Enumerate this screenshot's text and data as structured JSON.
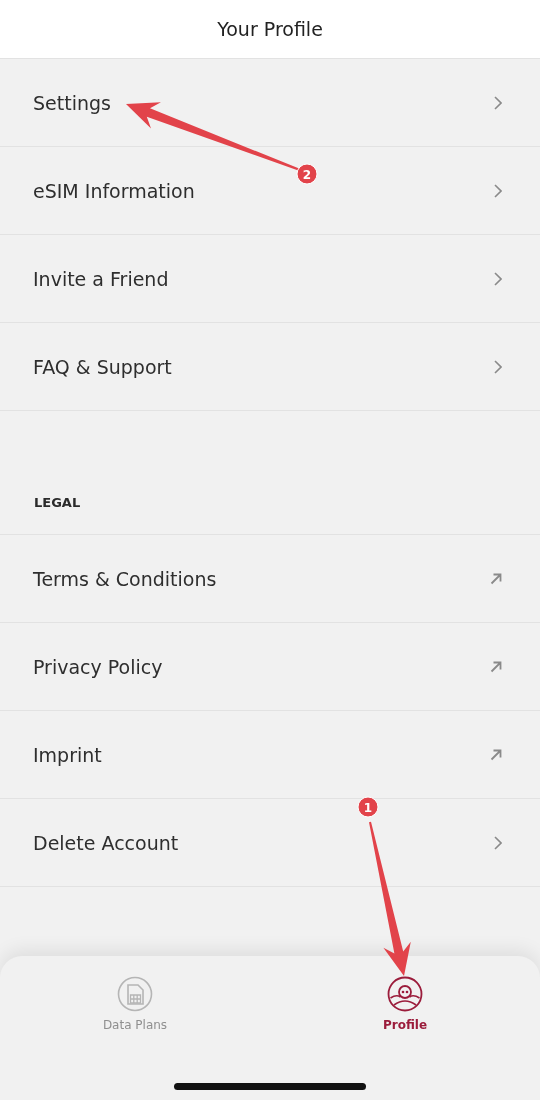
{
  "header": {
    "title": "Your Profile"
  },
  "menu": [
    {
      "label": "Settings",
      "kind": "chevron"
    },
    {
      "label": "eSIM Information",
      "kind": "chevron"
    },
    {
      "label": "Invite a Friend",
      "kind": "chevron"
    },
    {
      "label": "FAQ & Support",
      "kind": "chevron"
    }
  ],
  "legal": {
    "heading": "LEGAL",
    "items": [
      {
        "label": "Terms & Conditions",
        "kind": "external"
      },
      {
        "label": "Privacy Policy",
        "kind": "external"
      },
      {
        "label": "Imprint",
        "kind": "external"
      },
      {
        "label": "Delete Account",
        "kind": "chevron"
      }
    ]
  },
  "tabs": [
    {
      "label": "Data Plans",
      "kind": "sim",
      "selected": false
    },
    {
      "label": "Profile",
      "kind": "profile",
      "selected": true
    }
  ],
  "annotations": [
    {
      "label": "2"
    },
    {
      "label": "1"
    }
  ]
}
